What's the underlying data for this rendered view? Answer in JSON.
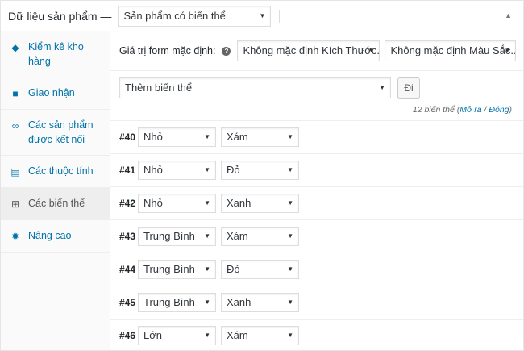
{
  "header": {
    "title": "Dữ liệu sản phẩm —",
    "product_type": "Sản phẩm có biến thể"
  },
  "tabs": [
    {
      "icon": "tag-icon",
      "label": "Kiểm kê kho hàng"
    },
    {
      "icon": "truck-icon",
      "label": "Giao nhận"
    },
    {
      "icon": "link-icon",
      "label": "Các sản phẩm được kết nối"
    },
    {
      "icon": "list-icon",
      "label": "Các thuộc tính"
    },
    {
      "icon": "grid-icon",
      "label": "Các biến thể"
    },
    {
      "icon": "gear-icon",
      "label": "Nâng cao"
    }
  ],
  "active_tab": "Các biến thể",
  "defaults": {
    "label": "Giá trị form mặc định:",
    "size_select": "Không mặc định Kích Thước...",
    "color_select": "Không mặc định Màu Sắc..."
  },
  "actions": {
    "select": "Thêm biến thể",
    "go_label": "Đi",
    "count_text": "12 biến thể",
    "expand_label": "Mở ra",
    "separator": "/",
    "collapse_label": "Đóng"
  },
  "variations": [
    {
      "id": "#40",
      "size": "Nhỏ",
      "color": "Xám"
    },
    {
      "id": "#41",
      "size": "Nhỏ",
      "color": "Đỏ"
    },
    {
      "id": "#42",
      "size": "Nhỏ",
      "color": "Xanh"
    },
    {
      "id": "#43",
      "size": "Trung Bình",
      "color": "Xám"
    },
    {
      "id": "#44",
      "size": "Trung Bình",
      "color": "Đỏ"
    },
    {
      "id": "#45",
      "size": "Trung Bình",
      "color": "Xanh"
    },
    {
      "id": "#46",
      "size": "Lớn",
      "color": "Xám"
    }
  ]
}
